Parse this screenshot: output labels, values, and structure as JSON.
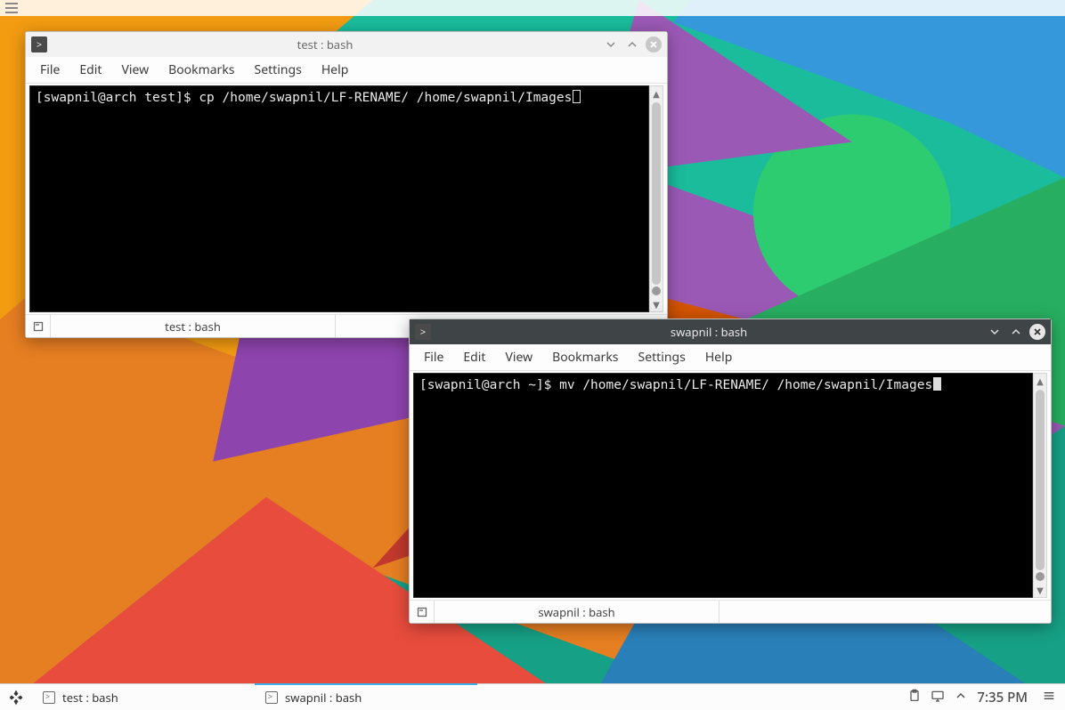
{
  "menus": {
    "file": "File",
    "edit": "Edit",
    "view": "View",
    "bookmarks": "Bookmarks",
    "settings": "Settings",
    "help": "Help"
  },
  "window1": {
    "title": "test : bash",
    "prompt": "[swapnil@arch test]$ ",
    "command": "cp /home/swapnil/LF-RENAME/ /home/swapnil/Images",
    "tab_label": "test : bash"
  },
  "window2": {
    "title": "swapnil : bash",
    "prompt": "[swapnil@arch ~]$ ",
    "command": "mv /home/swapnil/LF-RENAME/ /home/swapnil/Images",
    "tab_label": "swapnil : bash"
  },
  "taskbar": {
    "task1": "test : bash",
    "task2": "swapnil : bash",
    "clock": "7:35 PM"
  }
}
